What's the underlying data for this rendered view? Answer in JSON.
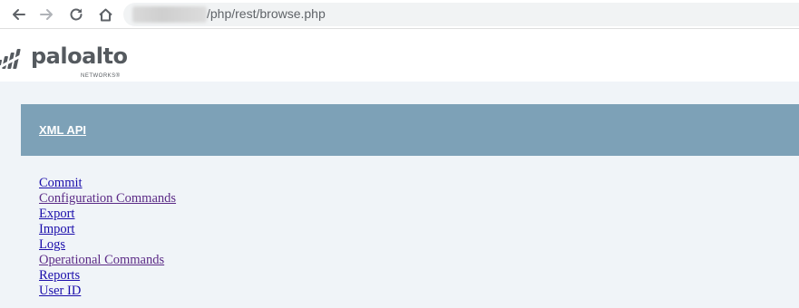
{
  "browser": {
    "url_path": "/php/rest/browse.php",
    "icons": {
      "back": "arrow-left-icon",
      "forward": "arrow-right-icon",
      "reload": "reload-icon",
      "home": "home-icon"
    }
  },
  "logo": {
    "name": "paloalto",
    "sub": "NETWORKS®"
  },
  "header": {
    "title": "XML API"
  },
  "links": [
    {
      "label": "Commit"
    },
    {
      "label": "Configuration Commands"
    },
    {
      "label": "Export"
    },
    {
      "label": "Import"
    },
    {
      "label": "Logs"
    },
    {
      "label": "Operational Commands"
    },
    {
      "label": "Reports"
    },
    {
      "label": "User ID"
    }
  ],
  "colors": {
    "header_bg": "#7da1b7",
    "content_bg": "#f0f4f8",
    "link": "#1a0dab",
    "visited_link": "#5b2a86"
  }
}
